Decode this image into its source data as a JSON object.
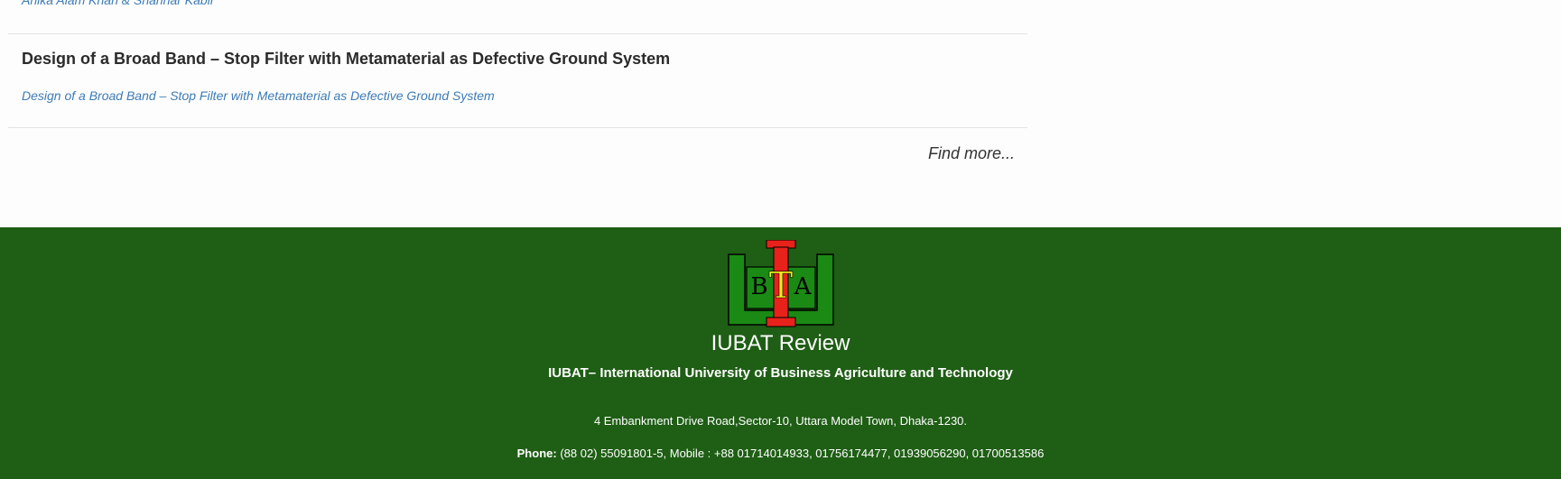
{
  "articles": [
    {
      "authors": "Anika Alam Khan & Shahriar Kabir"
    },
    {
      "title": "Design of a Broad Band – Stop Filter with Metamaterial as Defective Ground System",
      "subtitle": "Design of a Broad Band – Stop Filter with Metamaterial as Defective Ground System"
    }
  ],
  "find_more": "Find more...",
  "footer": {
    "logo_letters": {
      "left": "B",
      "middle": "T",
      "right": "A"
    },
    "site_name": "IUBAT Review",
    "tagline": "IUBAT– International University of Business Agriculture and Technology",
    "address": "4 Embankment Drive Road,Sector-10, Uttara Model Town, Dhaka-1230.",
    "phone_label": "Phone:",
    "phone_value": "(88 02) 55091801-5, Mobile : +88 01714014933, 01756174477, 01939056290, 01700513586",
    "colors": {
      "background": "#1f5e15",
      "logo_green": "#1a8a14",
      "logo_red": "#e8221b",
      "logo_yellow": "#f4ee1c"
    }
  }
}
